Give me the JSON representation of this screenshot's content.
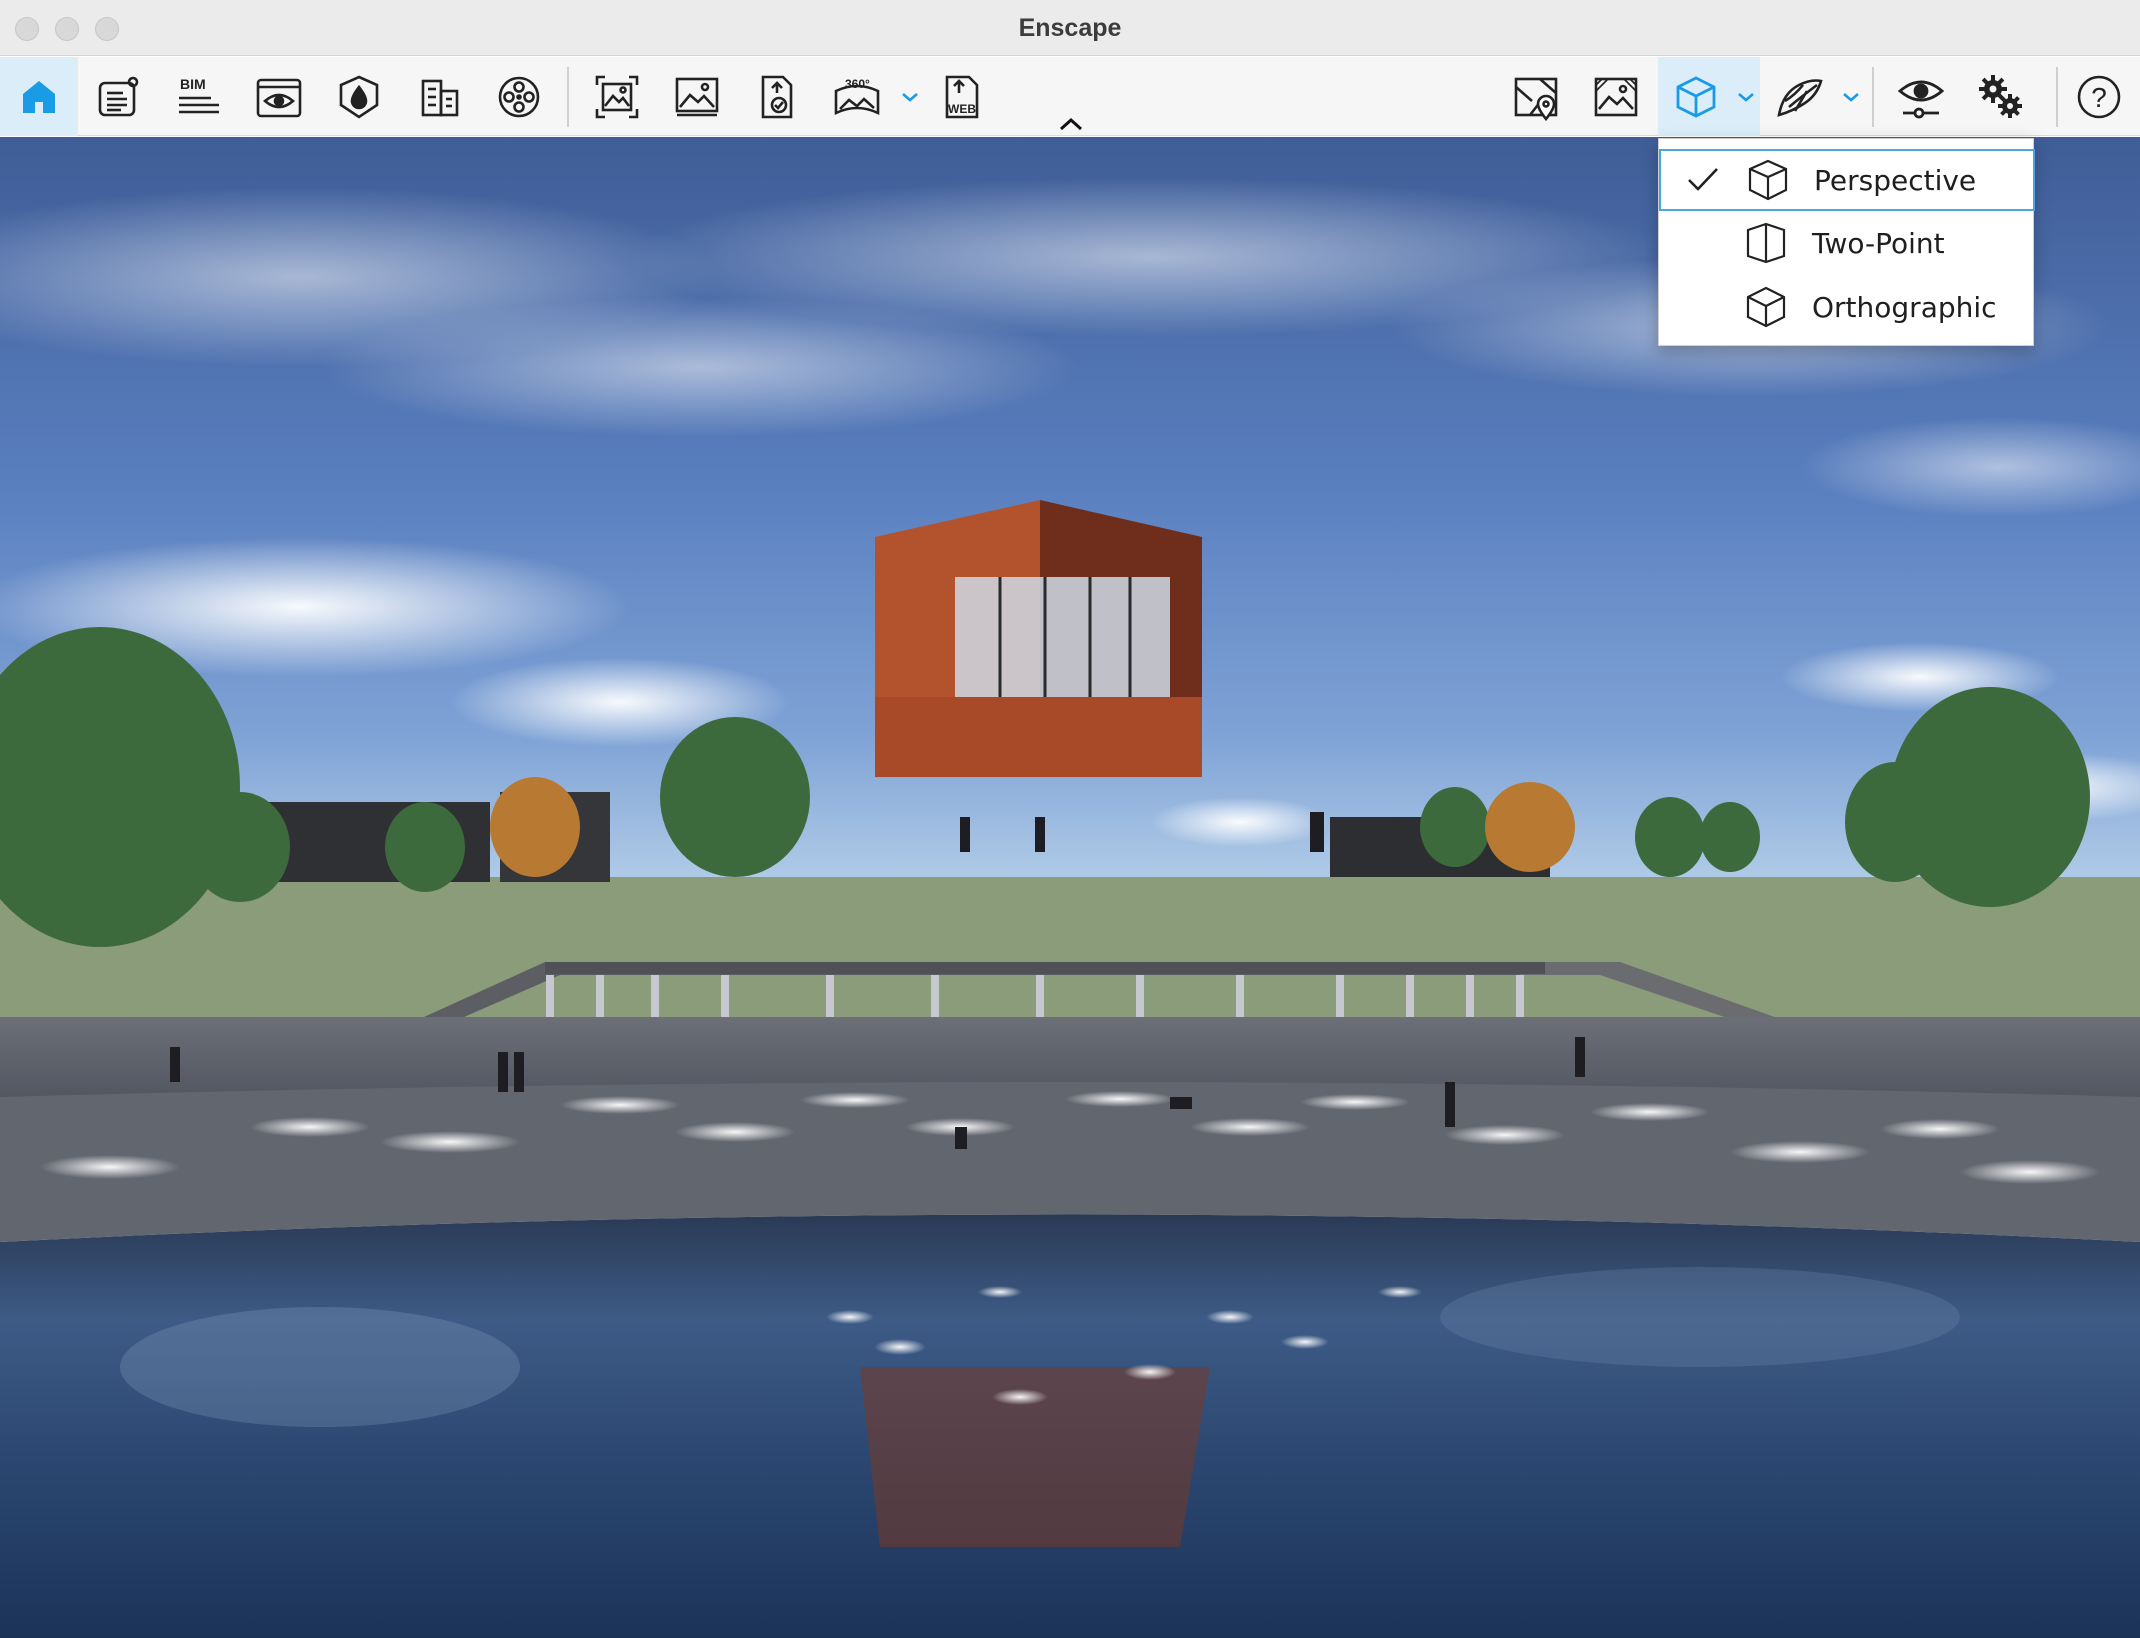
{
  "window": {
    "title": "Enscape"
  },
  "toolbar": {
    "buttons": [
      {
        "name": "home",
        "icon": "home-icon",
        "active": true
      },
      {
        "name": "info-panel",
        "icon": "info-panel-icon"
      },
      {
        "name": "bim",
        "icon": "bim-icon",
        "label": "BIM"
      },
      {
        "name": "view-management",
        "icon": "eye-window-icon"
      },
      {
        "name": "visual-settings",
        "icon": "shield-drop-icon"
      },
      {
        "name": "asset-library",
        "icon": "buildings-icon"
      },
      {
        "name": "video-editor",
        "icon": "film-reel-icon"
      },
      {
        "name": "render-screenshot",
        "icon": "screenshot-icon"
      },
      {
        "name": "batch-render",
        "icon": "image-icon"
      },
      {
        "name": "upload-export",
        "icon": "upload-file-icon"
      },
      {
        "name": "panorama",
        "icon": "panorama-360-icon",
        "label": "360°"
      },
      {
        "name": "web-export",
        "icon": "web-export-icon",
        "label": "WEB"
      },
      {
        "name": "minimap",
        "icon": "map-pin-icon"
      },
      {
        "name": "view-image",
        "icon": "hatched-image-icon"
      },
      {
        "name": "projection",
        "icon": "cube-icon",
        "active": true
      },
      {
        "name": "fly-mode",
        "icon": "wing-icon"
      },
      {
        "name": "capture-visibility",
        "icon": "eye-slider-icon"
      },
      {
        "name": "settings",
        "icon": "gears-icon"
      },
      {
        "name": "help",
        "icon": "help-icon",
        "label": "?"
      }
    ]
  },
  "projection_menu": {
    "items": [
      {
        "label": "Perspective",
        "selected": true,
        "icon": "cube-perspective-icon"
      },
      {
        "label": "Two-Point",
        "selected": false,
        "icon": "cube-two-point-icon"
      },
      {
        "label": "Orthographic",
        "selected": false,
        "icon": "cube-orthographic-icon"
      }
    ]
  },
  "colors": {
    "accent": "#1a9be6",
    "active_bg": "#dcedfa",
    "selected_border": "#4aa6e0",
    "icon_dark": "#222222"
  }
}
